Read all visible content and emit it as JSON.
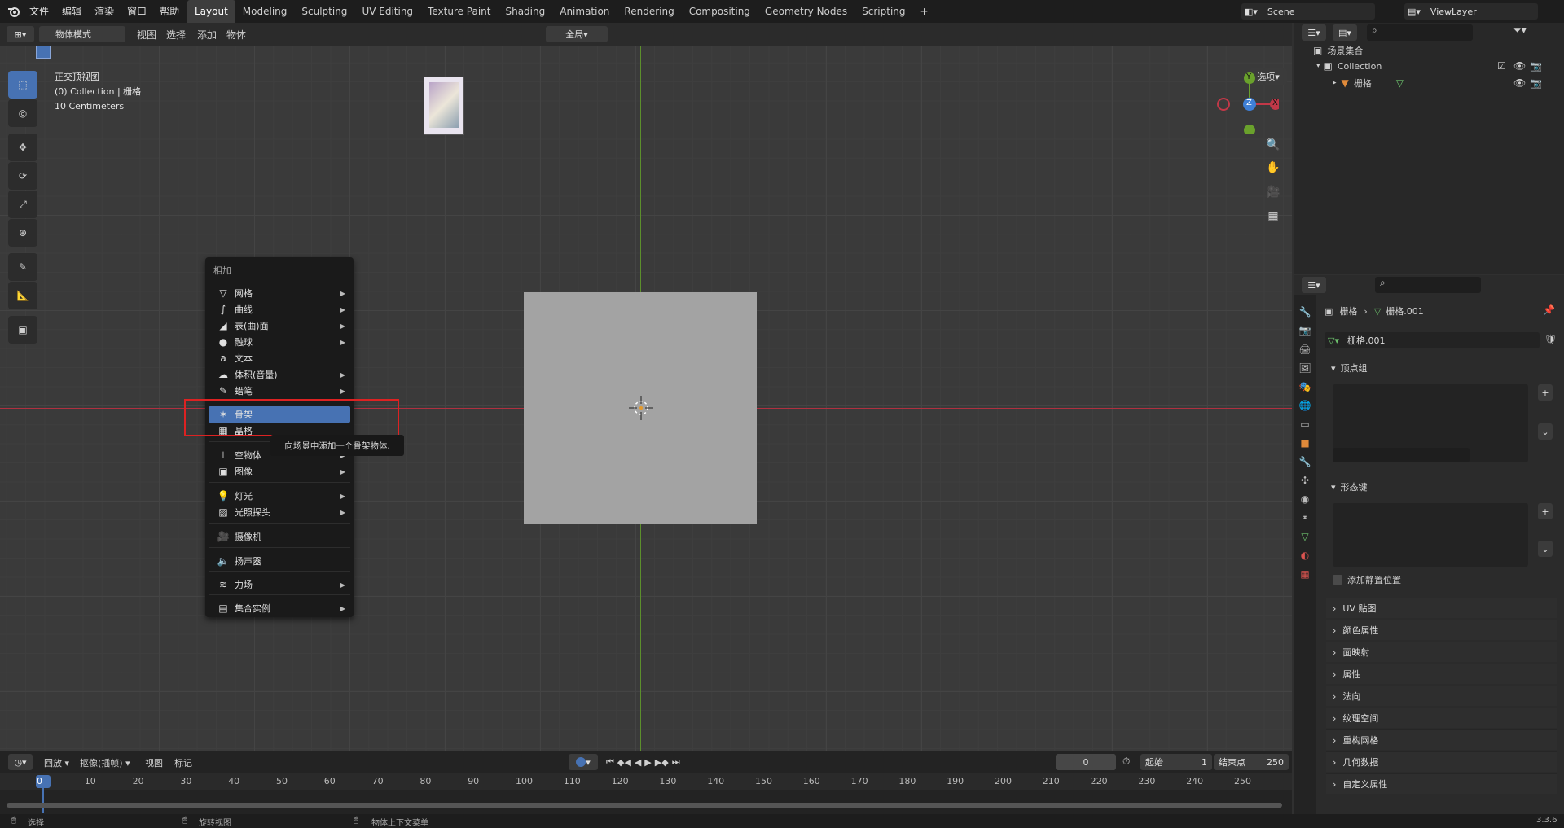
{
  "menus": [
    "文件",
    "编辑",
    "渲染",
    "窗口",
    "帮助"
  ],
  "workspaces": [
    "Layout",
    "Modeling",
    "Sculpting",
    "UV Editing",
    "Texture Paint",
    "Shading",
    "Animation",
    "Rendering",
    "Compositing",
    "Geometry Nodes",
    "Scripting"
  ],
  "scene_name": "Scene",
  "view_layer": "ViewLayer",
  "viewport_header": {
    "mode": "物体模式",
    "view": "视图",
    "select": "选择",
    "add": "添加",
    "object": "物体",
    "transform": "全局",
    "options": "选项"
  },
  "overlay_text": {
    "view_name": "正交顶视图",
    "collection": "(0) Collection | 栅格",
    "scale": "10 Centimeters"
  },
  "gizmo": {
    "y": "Y",
    "z": "Z",
    "x": "X"
  },
  "context_menu": {
    "title": "相加",
    "items": [
      {
        "label": "网格",
        "icon": "mesh-icon",
        "glyph": "▽",
        "sub": true
      },
      {
        "label": "曲线",
        "icon": "curve-icon",
        "glyph": "∫",
        "sub": true
      },
      {
        "label": "表(曲)面",
        "icon": "surface-icon",
        "glyph": "◢",
        "sub": true
      },
      {
        "label": "融球",
        "icon": "metaball-icon",
        "glyph": "●",
        "sub": true
      },
      {
        "label": "文本",
        "icon": "text-icon",
        "glyph": "a",
        "sub": false
      },
      {
        "label": "体积(音量)",
        "icon": "volume-icon",
        "glyph": "☁",
        "sub": true
      },
      {
        "label": "蜡笔",
        "icon": "grease-pencil-icon",
        "glyph": "✎",
        "sub": true
      },
      {
        "label": "骨架",
        "icon": "armature-icon",
        "glyph": "✶",
        "sub": false
      },
      {
        "label": "晶格",
        "icon": "lattice-icon",
        "glyph": "▦",
        "sub": false
      },
      {
        "label": "空物体",
        "icon": "empty-icon",
        "glyph": "⊥",
        "sub": true
      },
      {
        "label": "图像",
        "icon": "image-icon",
        "glyph": "▣",
        "sub": true
      },
      {
        "label": "灯光",
        "icon": "light-icon",
        "glyph": "💡",
        "sub": true
      },
      {
        "label": "光照探头",
        "icon": "light-probe-icon",
        "glyph": "▨",
        "sub": true
      },
      {
        "label": "摄像机",
        "icon": "camera-icon",
        "glyph": "🎥",
        "sub": false
      },
      {
        "label": "扬声器",
        "icon": "speaker-icon",
        "glyph": "🔈",
        "sub": false
      },
      {
        "label": "力场",
        "icon": "force-field-icon",
        "glyph": "≋",
        "sub": true
      },
      {
        "label": "集合实例",
        "icon": "collection-instance-icon",
        "glyph": "▤",
        "sub": true
      }
    ],
    "tooltip": "向场景中添加一个骨架物体."
  },
  "outliner": {
    "root": "场景集合",
    "collection": "Collection",
    "object": "栅格"
  },
  "properties": {
    "breadcrumb_obj": "栅格",
    "breadcrumb_data": "栅格.001",
    "data_name": "栅格.001",
    "vertex_groups": "顶点组",
    "shape_keys": "形态键",
    "add_rest_position": "添加静置位置",
    "panels": [
      "UV 贴图",
      "颜色属性",
      "面映射",
      "属性",
      "法向",
      "纹理空间",
      "重构网格",
      "几何数据",
      "自定义属性"
    ]
  },
  "timeline": {
    "playback": "回放",
    "keying": "抠像(插帧)",
    "view": "视图",
    "marker": "标记",
    "current_frame": "0",
    "start_label": "起始",
    "start": "1",
    "end_label": "结束点",
    "end": "250",
    "ticks": [
      "0",
      "10",
      "20",
      "30",
      "40",
      "50",
      "60",
      "70",
      "80",
      "90",
      "100",
      "110",
      "120",
      "130",
      "140",
      "150",
      "160",
      "170",
      "180",
      "190",
      "200",
      "210",
      "220",
      "230",
      "240",
      "250"
    ]
  },
  "status": {
    "select": "选择",
    "rotate": "旋转视图",
    "context": "物体上下文菜单",
    "version": "3.3.6"
  }
}
